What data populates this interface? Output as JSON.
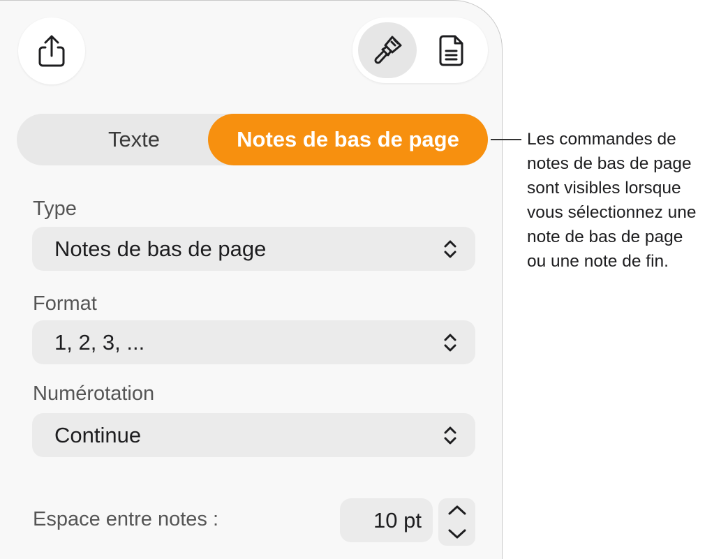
{
  "toolbar": {
    "share_icon": "share-icon",
    "format_icon": "paintbrush-icon",
    "document_icon": "document-icon"
  },
  "tabs": [
    {
      "label": "Texte",
      "selected": false
    },
    {
      "label": "Notes de bas de page",
      "selected": true
    }
  ],
  "accent_color": "#f7900f",
  "fields": {
    "type": {
      "label": "Type",
      "value": "Notes de bas de page"
    },
    "format": {
      "label": "Format",
      "value": "1, 2, 3, ..."
    },
    "numbering": {
      "label": "Numérotation",
      "value": "Continue"
    },
    "spacing": {
      "label": "Espace entre notes :",
      "value": "10 pt"
    }
  },
  "callout": {
    "text": "Les commandes de\nnotes de bas de page\nsont visibles lorsque\nvous sélectionnez une\nnote de bas de page\nou une note de fin."
  }
}
